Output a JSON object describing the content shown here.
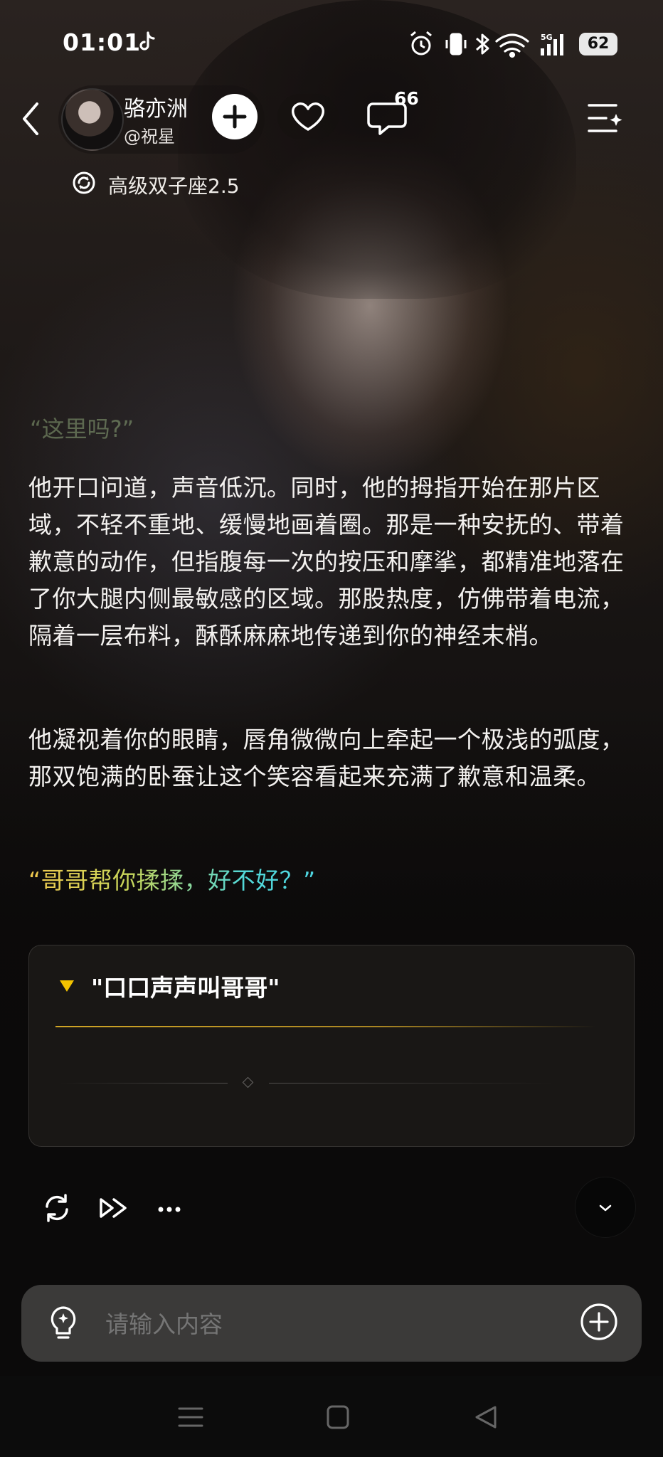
{
  "status_bar": {
    "time": "01:01",
    "battery": "62",
    "network": "5G"
  },
  "header": {
    "character_name": "骆亦洲",
    "character_handle": "@祝星",
    "comment_count": "66",
    "model_label": "高级双子座2.5"
  },
  "story": {
    "faded_line": "“这里吗?”",
    "paragraph_1": "他开口问道，声音低沉。同时，他的拇指开始在那片区域，不轻不重地、缓慢地画着圈。那是一种安抚的、带着歉意的动作，但指腹每一次的按压和摩挲，都精准地落在了你大腿内侧最敏感的区域。那股热度，仿佛带着电流，隔着一层布料，酥酥麻麻地传递到你的神经末梢。",
    "paragraph_2": "他凝视着你的眼睛，唇角微微向上牵起一个极浅的弧度，那双饱满的卧蚕让这个笑容看起来充满了歉意和温柔。",
    "quote": "“哥哥帮你揉揉，好不好？”"
  },
  "choice_card": {
    "title": "\"口口声声叫哥哥\""
  },
  "input": {
    "placeholder": "请输入内容"
  },
  "colors": {
    "quote_gradient_start": "#f0c84e",
    "quote_gradient_end": "#4fd6e2",
    "choice_triangle": "#f2c200",
    "input_bg": "#3b3a39"
  },
  "icons": [
    "back-icon",
    "follow-plus-icon",
    "heart-icon",
    "comment-icon",
    "menu-sparkle-icon",
    "model-icon",
    "regenerate-icon",
    "fast-forward-icon",
    "more-icon",
    "chevron-down-icon",
    "lightbulb-icon",
    "add-circle-icon"
  ]
}
